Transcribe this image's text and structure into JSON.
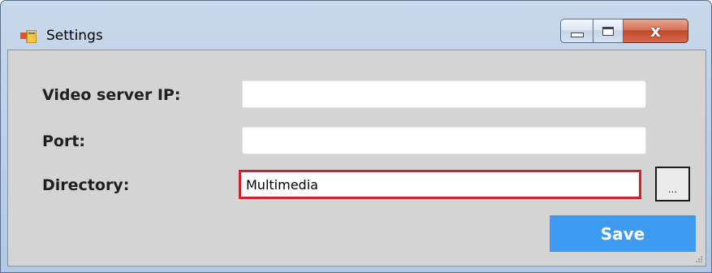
{
  "window": {
    "title": "Settings",
    "icon": "app-form-icon",
    "close_glyph": "x"
  },
  "form": {
    "video_server_ip": {
      "label": "Video server IP:",
      "value": ""
    },
    "port": {
      "label": "Port:",
      "value": ""
    },
    "directory": {
      "label": "Directory:",
      "value": "Multimedia"
    },
    "browse_label": "...",
    "save_label": "Save"
  },
  "colors": {
    "save_button": "#3d9cf2",
    "focus_border": "#d0202c",
    "client_background": "#d4d4d4"
  }
}
